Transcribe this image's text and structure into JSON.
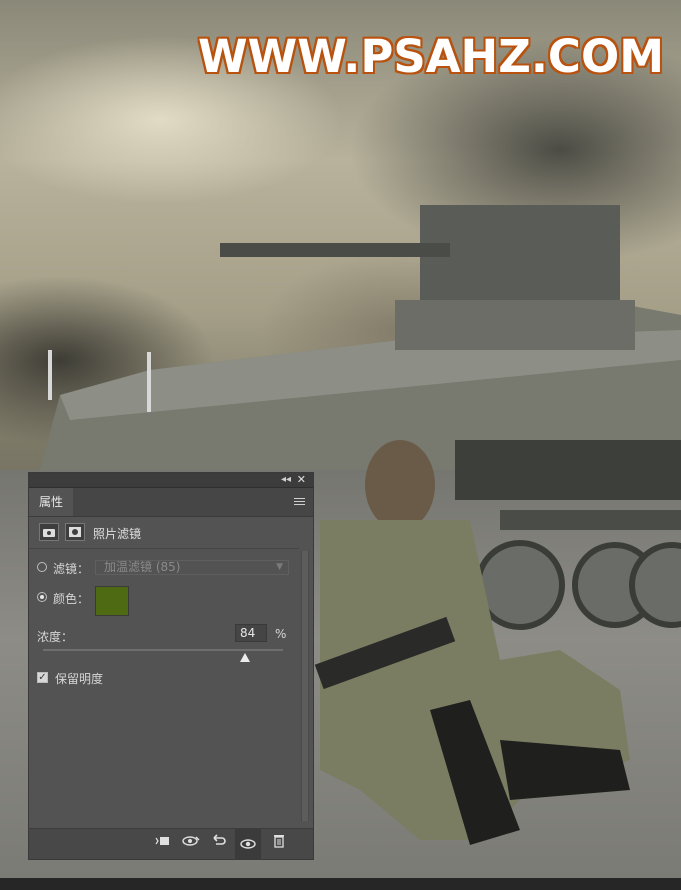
{
  "watermark": {
    "text": "WWW.PSAHZ.COM"
  },
  "panel": {
    "tab_label": "属性",
    "header_title": "照片滤镜",
    "filter_radio_label": "滤镜：",
    "filter_select_value": "加温滤镜 (85)",
    "color_radio_label": "颜色：",
    "color_value": "#4e6a13",
    "density_label": "浓度：",
    "density_value": "84",
    "density_unit": "%",
    "density_percent": 84,
    "preserve_luminosity_label": "保留明度",
    "preserve_luminosity_checked": true,
    "selected_mode": "color"
  },
  "icons": {
    "titlebar": [
      "collapse-icon",
      "close-icon"
    ],
    "header": [
      "adjustment-camera-icon",
      "layer-mask-icon"
    ],
    "footer": [
      "clip-to-layer-icon",
      "view-previous-state-icon",
      "reset-icon",
      "visibility-eye-icon",
      "trash-icon"
    ]
  }
}
